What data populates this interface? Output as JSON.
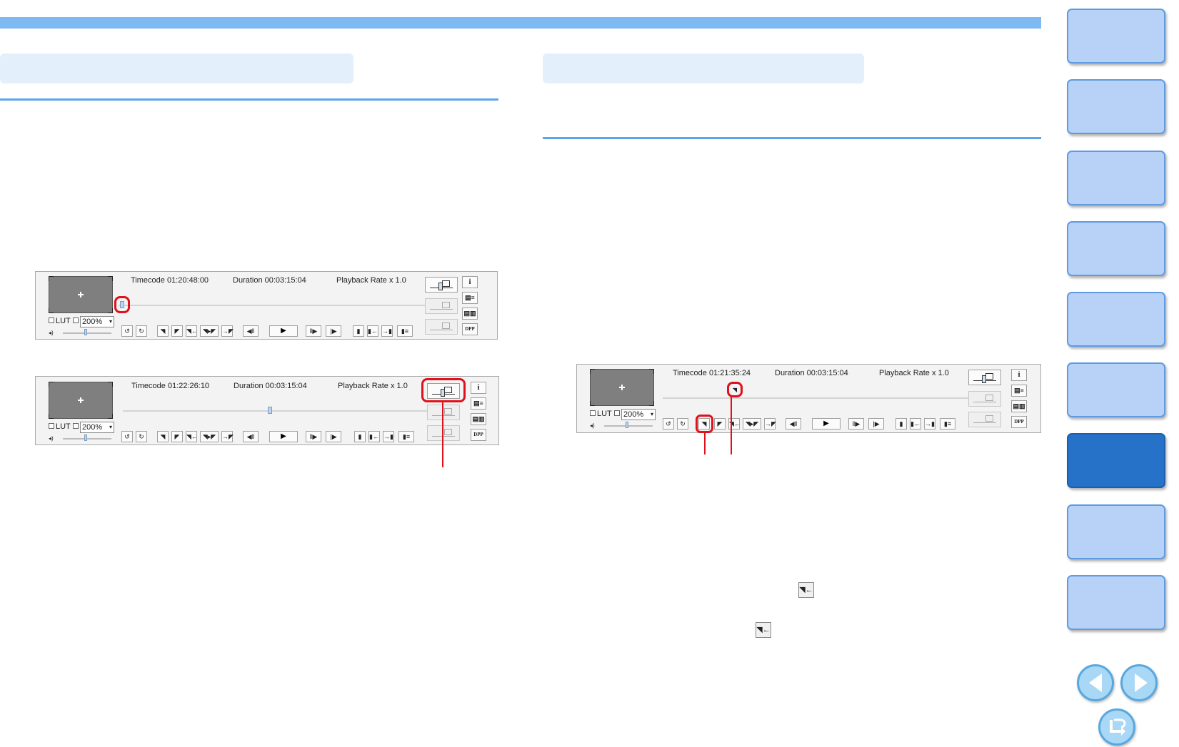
{
  "colors": {
    "accent": "#7fb9f4",
    "highlight": "#e0101c",
    "nav_active": "#2672c8",
    "nav_inactive": "#b7d2f6"
  },
  "player1": {
    "timecode": "Timecode 01:20:48:00",
    "duration": "Duration 00:03:15:04",
    "playback_rate": "Playback Rate x 1.0",
    "lut_label": "LUT",
    "zoom": "200%",
    "info_icon": "i"
  },
  "player2": {
    "timecode": "Timecode 01:22:26:10",
    "duration": "Duration 00:03:15:04",
    "playback_rate": "Playback Rate x 1.0",
    "lut_label": "LUT",
    "zoom": "200%",
    "info_icon": "i"
  },
  "player3": {
    "timecode": "Timecode 01:21:35:24",
    "duration": "Duration 00:03:15:04",
    "playback_rate": "Playback Rate x 1.0",
    "lut_label": "LUT",
    "zoom": "200%",
    "info_icon": "i"
  },
  "icons": {
    "in_point": "in-point-icon",
    "out_point": "out-point-icon",
    "go_to_in": "go-to-in-point-icon",
    "play": "play-icon",
    "nav_prev": "previous-page-icon",
    "nav_next": "next-page-icon",
    "nav_return": "return-icon"
  },
  "glyphs": {
    "play": "▶",
    "prev_frame": "◀‖",
    "next_frame": "‖▶",
    "prev_clip": "◀|",
    "next_clip": "|▶",
    "in": "◥",
    "out": "◤",
    "go_in": "◥←",
    "in_out": "◥▸◤",
    "go_out": "→◤"
  }
}
